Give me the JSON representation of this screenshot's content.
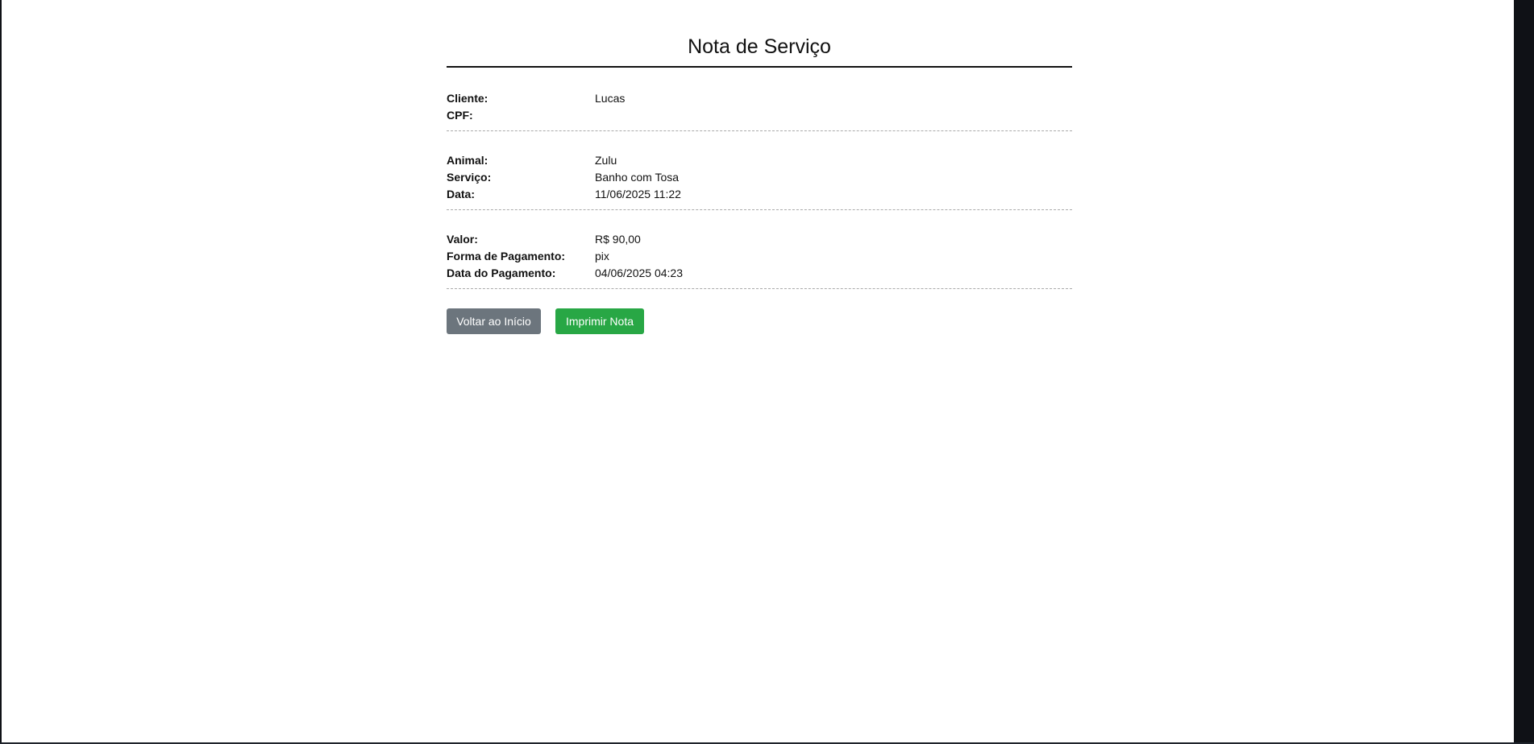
{
  "note": {
    "title": "Nota de Serviço",
    "client": {
      "label": "Cliente:",
      "value": "Lucas",
      "cpf_label": "CPF:",
      "cpf_value": ""
    },
    "service": {
      "animal_label": "Animal:",
      "animal_value": "Zulu",
      "service_label": "Serviço:",
      "service_value": "Banho com Tosa",
      "date_label": "Data:",
      "date_value": "11/06/2025 11:22"
    },
    "payment": {
      "amount_label": "Valor:",
      "amount_value": "R$ 90,00",
      "method_label": "Forma de Pagamento:",
      "method_value": "pix",
      "paid_date_label": "Data do Pagamento:",
      "paid_date_value": "04/06/2025 04:23"
    },
    "actions": {
      "back_label": "Voltar ao Início",
      "print_label": "Imprimir Nota"
    },
    "colors": {
      "secondary": "#6c757d",
      "success": "#28a745"
    }
  }
}
